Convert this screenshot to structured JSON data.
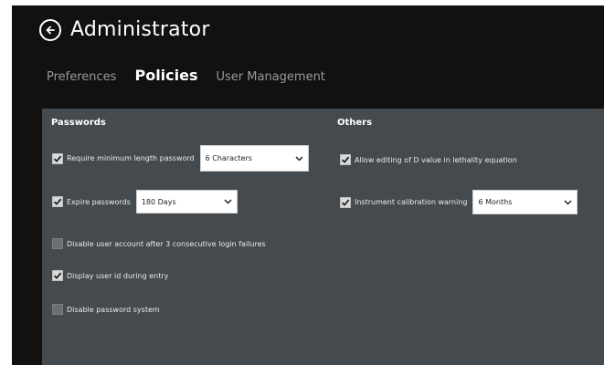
{
  "header": {
    "title": "Administrator",
    "back_icon": "arrow-left-circle-icon"
  },
  "tabs": [
    {
      "label": "Preferences",
      "active": false
    },
    {
      "label": "Policies",
      "active": true
    },
    {
      "label": "User Management",
      "active": false
    }
  ],
  "passwords": {
    "title": "Passwords",
    "min_length": {
      "label": "Require minimum length password",
      "checked": true,
      "value": "6 Characters"
    },
    "expire": {
      "label": "Expire passwords",
      "checked": true,
      "value": "180 Days"
    },
    "disable_account": {
      "label": "Disable user account after 3 consecutive login failures",
      "checked": false
    },
    "display_userid": {
      "label": "Display user id during entry",
      "checked": true
    },
    "disable_system": {
      "label": "Disable password system",
      "checked": false
    }
  },
  "others": {
    "title": "Others",
    "allow_editing": {
      "label": "Allow editing of D value in lethality equation",
      "checked": true
    },
    "calibration": {
      "label": "Instrument calibration warning",
      "checked": true,
      "value": "6 Months"
    }
  },
  "colors": {
    "window_bg": "#111111",
    "panel_bg": "#444a4d",
    "tab_inactive": "#9a9a9a",
    "text": "#ffffff"
  }
}
